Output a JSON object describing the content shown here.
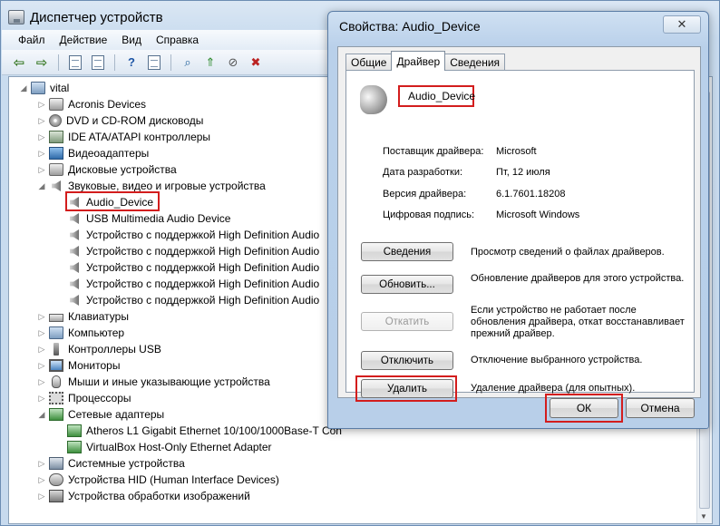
{
  "window": {
    "title": "Диспетчер устройств"
  },
  "menu": [
    "Файл",
    "Действие",
    "Вид",
    "Справка"
  ],
  "toolbar": [
    "back-icon",
    "forward-icon",
    "show-hide-icon",
    "properties-icon",
    "help-icon",
    "scan-hardware-icon",
    "update-driver-icon",
    "disable-icon",
    "uninstall-icon"
  ],
  "tree": {
    "root": "vital",
    "categories": [
      "Acronis Devices",
      "DVD и CD-ROM дисководы",
      "IDE ATA/ATAPI контроллеры",
      "Видеоадаптеры",
      "Дисковые устройства",
      "Звуковые, видео и игровые устройства",
      "Клавиатуры",
      "Компьютер",
      "Контроллеры USB",
      "Мониторы",
      "Мыши и иные указывающие устройства",
      "Процессоры",
      "Сетевые адаптеры",
      "Системные устройства",
      "Устройства HID (Human Interface Devices)",
      "Устройства обработки изображений"
    ],
    "sound_children": [
      "Audio_Device",
      "USB Multimedia Audio Device",
      "Устройство с поддержкой High Definition Audio",
      "Устройство с поддержкой High Definition Audio",
      "Устройство с поддержкой High Definition Audio",
      "Устройство с поддержкой High Definition Audio",
      "Устройство с поддержкой High Definition Audio"
    ],
    "network_children": [
      "Atheros L1 Gigabit Ethernet 10/100/1000Base-T Con",
      "VirtualBox Host-Only Ethernet Adapter"
    ]
  },
  "dialog": {
    "title": "Свойства: Audio_Device",
    "close": "✕",
    "tabs": [
      "Общие",
      "Драйвер",
      "Сведения"
    ],
    "device_name": "Audio_Device",
    "info": [
      {
        "label": "Поставщик драйвера:",
        "value": "Microsoft"
      },
      {
        "label": "Дата разработки:",
        "value": "Пт, 12 июля"
      },
      {
        "label": "Версия драйвера:",
        "value": "6.1.7601.18208"
      },
      {
        "label": "Цифровая подпись:",
        "value": "Microsoft Windows"
      }
    ],
    "actions": [
      {
        "label": "Сведения",
        "desc": "Просмотр сведений о файлах драйверов.",
        "disabled": false
      },
      {
        "label": "Обновить...",
        "desc": "Обновление драйверов для этого устройства.",
        "disabled": false
      },
      {
        "label": "Откатить",
        "desc": "Если устройство не работает после обновления драйвера, откат восстанавливает прежний драйвер.",
        "disabled": true
      },
      {
        "label": "Отключить",
        "desc": "Отключение выбранного устройства.",
        "disabled": false
      },
      {
        "label": "Удалить",
        "desc": "Удаление драйвера (для опытных).",
        "disabled": false
      }
    ],
    "ok": "ОК",
    "cancel": "Отмена"
  }
}
